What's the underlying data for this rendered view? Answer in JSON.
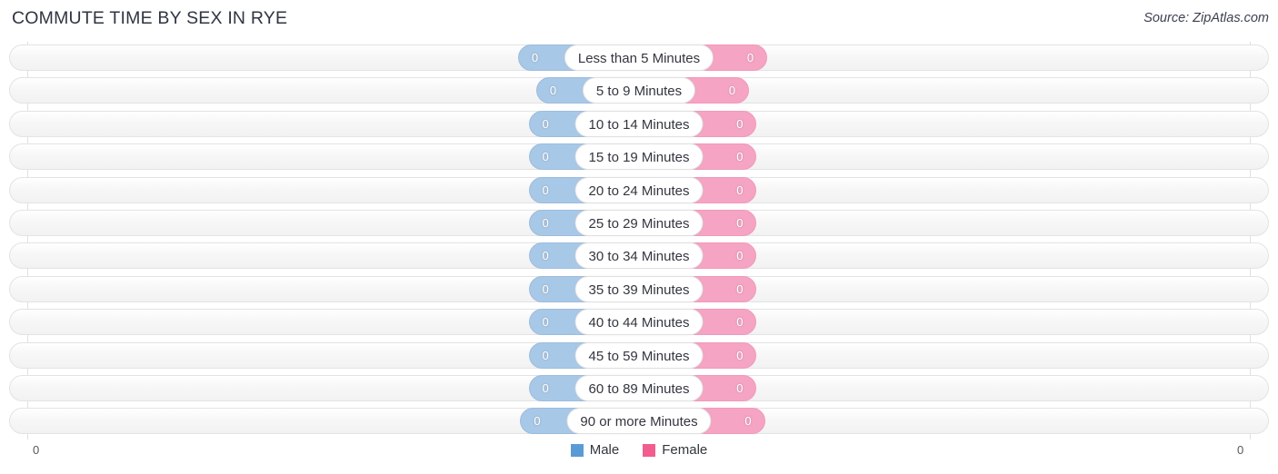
{
  "header": {
    "title": "COMMUTE TIME BY SEX IN RYE",
    "source": "Source: ZipAtlas.com"
  },
  "legend": {
    "male_label": "Male",
    "female_label": "Female",
    "male_color": "#5b9bd5",
    "female_color": "#f25d8f"
  },
  "axis": {
    "left_tick": "0",
    "right_tick": "0"
  },
  "colors": {
    "bar_male": "#a8c8e8",
    "bar_female": "#f6a4c3",
    "track": "#f4f4f4",
    "gridline": "#e0e0e0"
  },
  "chart_data": {
    "type": "bar",
    "title": "COMMUTE TIME BY SEX IN RYE",
    "subtitle": "Source: ZipAtlas.com",
    "orientation": "horizontal-diverging",
    "xlabel": "",
    "ylabel": "",
    "xlim": [
      0,
      0
    ],
    "grid": true,
    "legend_position": "bottom-center",
    "axis_ticks": [
      "0",
      "0"
    ],
    "categories": [
      "Less than 5 Minutes",
      "5 to 9 Minutes",
      "10 to 14 Minutes",
      "15 to 19 Minutes",
      "20 to 24 Minutes",
      "25 to 29 Minutes",
      "30 to 34 Minutes",
      "35 to 39 Minutes",
      "40 to 44 Minutes",
      "45 to 59 Minutes",
      "60 to 89 Minutes",
      "90 or more Minutes"
    ],
    "series": [
      {
        "name": "Male",
        "color": "#5b9bd5",
        "values": [
          0,
          0,
          0,
          0,
          0,
          0,
          0,
          0,
          0,
          0,
          0,
          0
        ],
        "value_labels": [
          "0",
          "0",
          "0",
          "0",
          "0",
          "0",
          "0",
          "0",
          "0",
          "0",
          "0",
          "0"
        ]
      },
      {
        "name": "Female",
        "color": "#f25d8f",
        "values": [
          0,
          0,
          0,
          0,
          0,
          0,
          0,
          0,
          0,
          0,
          0,
          0
        ],
        "value_labels": [
          "0",
          "0",
          "0",
          "0",
          "0",
          "0",
          "0",
          "0",
          "0",
          "0",
          "0",
          "0"
        ]
      }
    ]
  }
}
